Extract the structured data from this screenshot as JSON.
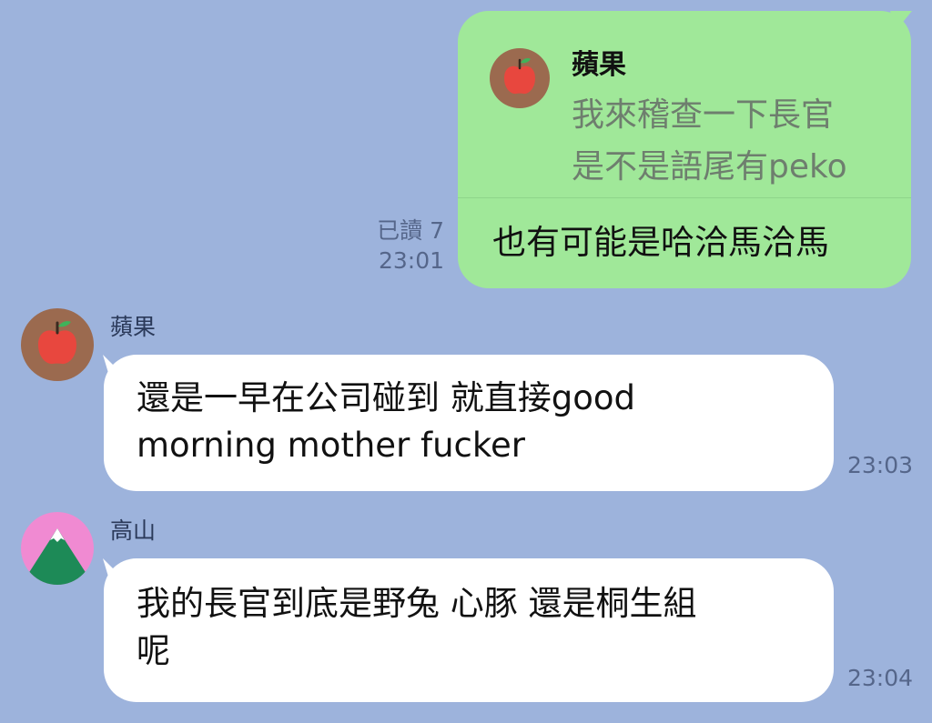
{
  "colors": {
    "chat_background": "#9db3dc",
    "outgoing_bubble": "#a0e899",
    "incoming_bubble": "#ffffff"
  },
  "outgoing": {
    "quote": {
      "avatar_icon": "apple-icon",
      "name": "蘋果",
      "text": "我來稽查一下長官\n是不是語尾有peko"
    },
    "text": "也有可能是哈洽馬洽馬",
    "read_status": "已讀 7",
    "time": "23:01"
  },
  "messages": [
    {
      "sender": "蘋果",
      "avatar_icon": "apple-icon",
      "text": "還是一早在公司碰到 就直接good\nmorning mother fucker",
      "time": "23:03"
    },
    {
      "sender": "高山",
      "avatar_icon": "mountain-icon",
      "text": "我的長官到底是野兔 心豚 還是桐生組\n呢",
      "time": "23:04"
    }
  ]
}
